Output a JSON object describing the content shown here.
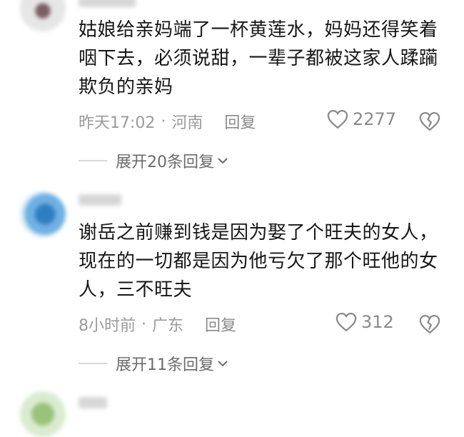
{
  "comments": [
    {
      "text": "姑娘给亲妈端了一杯黄莲水，妈妈还得笑着咽下去，必须说甜，一辈子都被这家人蹂躏欺负的亲妈",
      "time": "昨天17:02",
      "separator": "·",
      "location": "河南",
      "reply_label": "回复",
      "likes": "2277",
      "expand_label": "展开20条回复",
      "avatar_colors": [
        "#e3e3e3",
        "#8a6f73",
        "#f2f2f2"
      ]
    },
    {
      "text": "谢岳之前赚到钱是因为娶了个旺夫的女人，现在的一切都是因为他亏欠了那个旺他的女人，三不旺夫",
      "time": "8小时前",
      "separator": "·",
      "location": "广东",
      "reply_label": "回复",
      "likes": "312",
      "expand_label": "展开11条回复",
      "avatar_colors": [
        "#5aa0d8",
        "#2f7fbf",
        "#c8def0"
      ]
    }
  ],
  "icons": {
    "like": "heart-outline-icon",
    "dislike": "broken-heart-icon",
    "expand": "chevron-down-icon"
  }
}
